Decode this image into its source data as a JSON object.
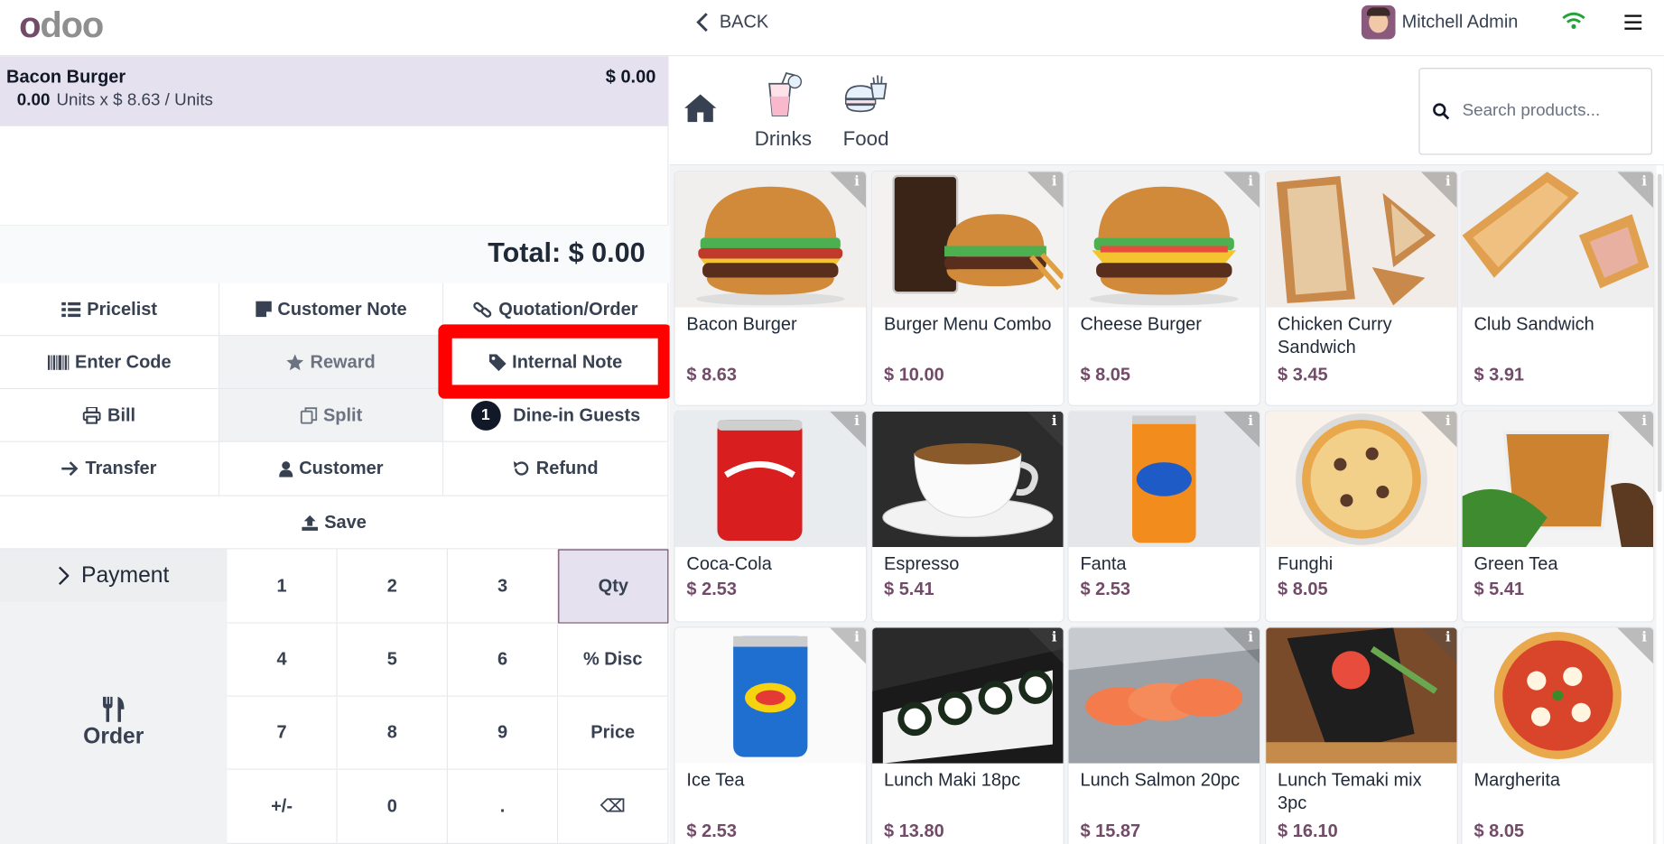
{
  "header": {
    "logo": "odoo",
    "back_label": "BACK",
    "user_name": "Mitchell Admin"
  },
  "order": {
    "line": {
      "name": "Bacon Burger",
      "price": "$ 0.00",
      "qty": "0.00",
      "detail": "Units x $ 8.63 / Units"
    },
    "total": "Total: $ 0.00"
  },
  "controls": {
    "pricelist": "Pricelist",
    "customer_note": "Customer Note",
    "quotation": "Quotation/Order",
    "enter_code": "Enter Code",
    "reward": "Reward",
    "internal_note": "Internal Note",
    "bill": "Bill",
    "split": "Split",
    "guests_count": "1",
    "dine_in": "Dine-in Guests",
    "transfer": "Transfer",
    "customer": "Customer",
    "refund": "Refund",
    "save": "Save"
  },
  "actions": {
    "payment": "Payment",
    "order": "Order"
  },
  "numpad": [
    "1",
    "2",
    "3",
    "Qty",
    "4",
    "5",
    "6",
    "% Disc",
    "7",
    "8",
    "9",
    "Price",
    "+/-",
    "0",
    ".",
    "⌫"
  ],
  "categories": [
    "Drinks",
    "Food"
  ],
  "search": {
    "placeholder": "Search products..."
  },
  "products": [
    {
      "name": "Bacon Burger",
      "price": "$ 8.63"
    },
    {
      "name": "Burger Menu Combo",
      "price": "$ 10.00"
    },
    {
      "name": "Cheese Burger",
      "price": "$ 8.05"
    },
    {
      "name": "Chicken Curry Sandwich",
      "price": "$ 3.45"
    },
    {
      "name": "Club Sandwich",
      "price": "$ 3.91"
    },
    {
      "name": "Coca-Cola",
      "price": "$ 2.53"
    },
    {
      "name": "Espresso",
      "price": "$ 5.41"
    },
    {
      "name": "Fanta",
      "price": "$ 2.53"
    },
    {
      "name": "Funghi",
      "price": "$ 8.05"
    },
    {
      "name": "Green Tea",
      "price": "$ 5.41"
    },
    {
      "name": "Ice Tea",
      "price": "$ 2.53"
    },
    {
      "name": "Lunch Maki 18pc",
      "price": "$ 13.80"
    },
    {
      "name": "Lunch Salmon 20pc",
      "price": "$ 15.87"
    },
    {
      "name": "Lunch Temaki mix 3pc",
      "price": "$ 16.10"
    },
    {
      "name": "Margherita",
      "price": "$ 8.05"
    }
  ],
  "colors": {
    "brand": "#714B67",
    "selected_line": "#e6e1ee",
    "highlight": "#ff0000"
  }
}
